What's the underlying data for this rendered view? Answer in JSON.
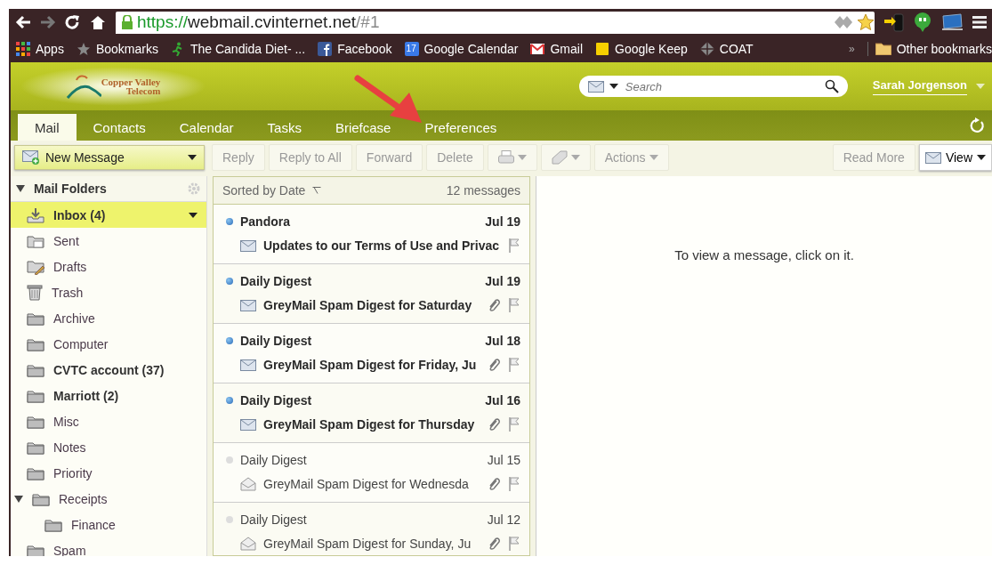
{
  "browser": {
    "url_scheme": "https://",
    "url_host": "webmail.cvinternet.net",
    "url_path": "/#1",
    "bookmarks": [
      {
        "label": "Apps",
        "kind": "apps"
      },
      {
        "label": "Bookmarks",
        "kind": "star"
      },
      {
        "label": "The Candida Diet- ...",
        "kind": "figure"
      },
      {
        "label": "Facebook",
        "kind": "facebook"
      },
      {
        "label": "Google Calendar",
        "kind": "calendar"
      },
      {
        "label": "Gmail",
        "kind": "mail"
      },
      {
        "label": "Google Keep",
        "kind": "note"
      },
      {
        "label": "COAT",
        "kind": "diamond"
      }
    ],
    "more_bookmarks": "»",
    "other_bookmarks": "Other bookmarks",
    "calendar_day": "17"
  },
  "header": {
    "logo_line1": "Copper Valley",
    "logo_line2": "Telecom",
    "search_placeholder": "Search",
    "user": "Sarah Jorgenson"
  },
  "tabs": [
    {
      "label": "Mail",
      "selected": true
    },
    {
      "label": "Contacts",
      "selected": false
    },
    {
      "label": "Calendar",
      "selected": false
    },
    {
      "label": "Tasks",
      "selected": false
    },
    {
      "label": "Briefcase",
      "selected": false
    },
    {
      "label": "Preferences",
      "selected": false
    }
  ],
  "toolbar": {
    "new_message": "New Message",
    "buttons": [
      {
        "kind": "text",
        "label": "Reply",
        "disabled": true
      },
      {
        "kind": "text",
        "label": "Reply to All",
        "disabled": true
      },
      {
        "kind": "text",
        "label": "Forward",
        "disabled": true
      },
      {
        "kind": "text",
        "label": "Delete",
        "disabled": true
      },
      {
        "kind": "print",
        "disabled": true
      },
      {
        "kind": "tag",
        "disabled": true
      },
      {
        "kind": "menu",
        "label": "Actions",
        "disabled": true
      }
    ],
    "read_more": {
      "label": "Read More",
      "disabled": true
    },
    "view": "View"
  },
  "folders": {
    "title": "Mail Folders",
    "items": [
      {
        "name": "Inbox (4)",
        "kind": "inbox",
        "bold": true,
        "selected": true
      },
      {
        "name": "Sent",
        "kind": "sent",
        "bold": false,
        "selected": false
      },
      {
        "name": "Drafts",
        "kind": "drafts",
        "bold": false,
        "selected": false
      },
      {
        "name": "Trash",
        "kind": "trash",
        "bold": false,
        "selected": false
      },
      {
        "name": "Archive",
        "kind": "folder",
        "bold": false,
        "selected": false
      },
      {
        "name": "Computer",
        "kind": "folder",
        "bold": false,
        "selected": false
      },
      {
        "name": "CVTC account (37)",
        "kind": "folder",
        "bold": true,
        "selected": false
      },
      {
        "name": "Marriott (2)",
        "kind": "folder",
        "bold": true,
        "selected": false
      },
      {
        "name": "Misc",
        "kind": "folder",
        "bold": false,
        "selected": false
      },
      {
        "name": "Notes",
        "kind": "folder",
        "bold": false,
        "selected": false
      },
      {
        "name": "Priority",
        "kind": "folder",
        "bold": false,
        "selected": false
      },
      {
        "name": "Receipts",
        "kind": "folder",
        "bold": false,
        "selected": false,
        "expanded": true,
        "children": [
          {
            "name": "Finance",
            "kind": "folder",
            "bold": false,
            "selected": false
          }
        ]
      },
      {
        "name": "Spam",
        "kind": "folder",
        "bold": false,
        "selected": false
      }
    ]
  },
  "message_list": {
    "sort": "Sorted by Date",
    "count": "12 messages",
    "messages": [
      {
        "sender": "Pandora",
        "date": "Jul 19",
        "subject": "Updates to our Terms of Use and Privac",
        "unread": true,
        "attachment": false
      },
      {
        "sender": "Daily Digest",
        "date": "Jul 19",
        "subject": "GreyMail Spam Digest for Saturday",
        "unread": true,
        "attachment": true
      },
      {
        "sender": "Daily Digest",
        "date": "Jul 18",
        "subject": "GreyMail Spam Digest for Friday, Ju",
        "unread": true,
        "attachment": true
      },
      {
        "sender": "Daily Digest",
        "date": "Jul 16",
        "subject": "GreyMail Spam Digest for Thursday",
        "unread": true,
        "attachment": true
      },
      {
        "sender": "Daily Digest",
        "date": "Jul 15",
        "subject": "GreyMail Spam Digest for Wednesda",
        "unread": false,
        "attachment": true
      },
      {
        "sender": "Daily Digest",
        "date": "Jul 12",
        "subject": "GreyMail Spam Digest for Sunday, Ju",
        "unread": false,
        "attachment": true
      }
    ]
  },
  "reading_pane": {
    "hint": "To view a message, click on it."
  }
}
